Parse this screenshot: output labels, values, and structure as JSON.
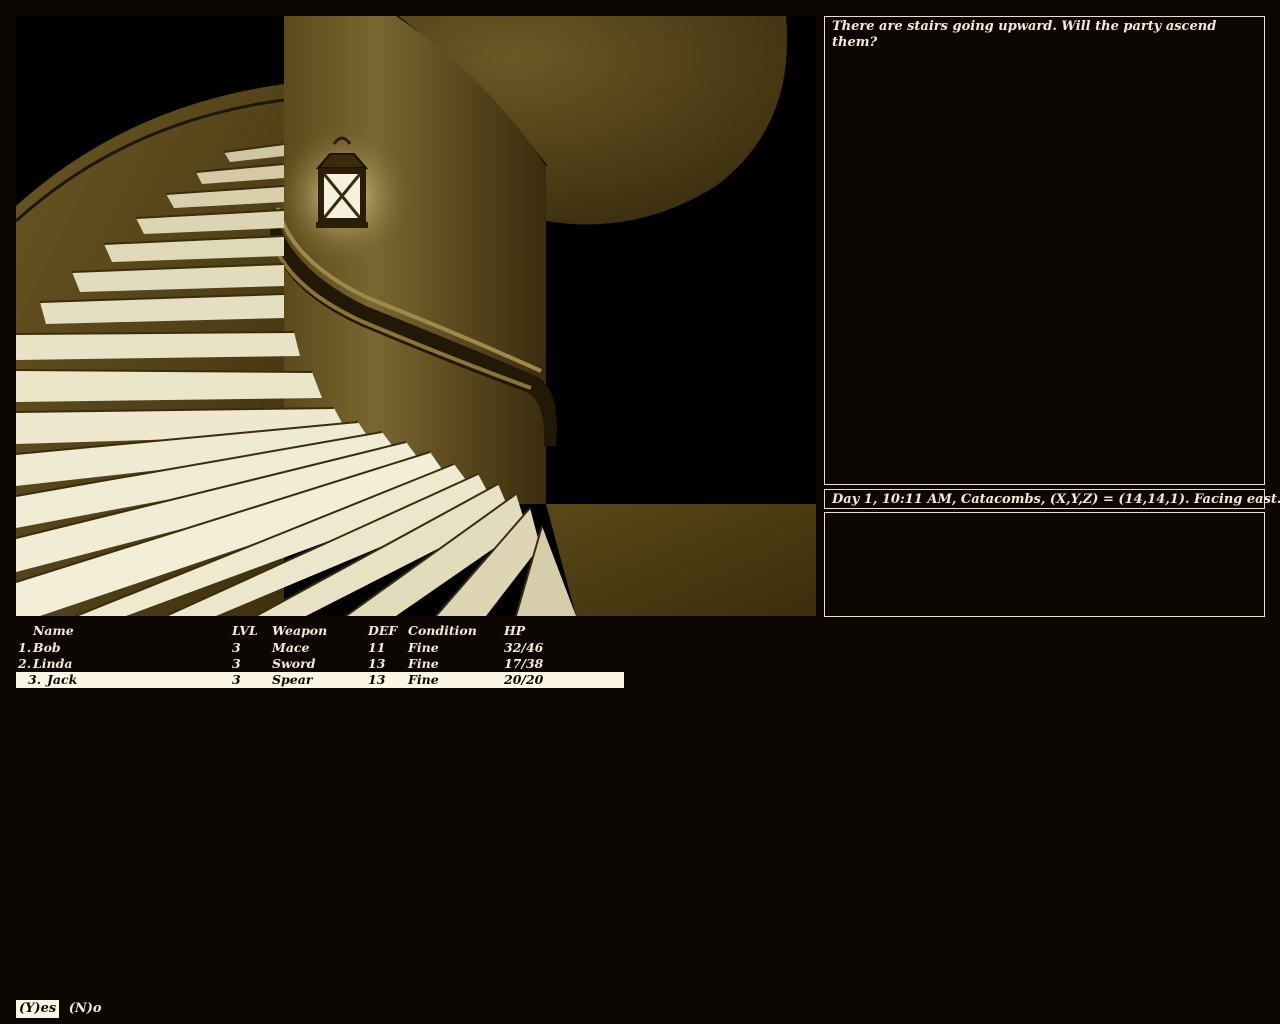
{
  "message": "There are stairs going upward. Will the party ascend them?",
  "status": "Day 1, 10:11 AM, Catacombs, (X,Y,Z) = (14,14,1). Facing east.",
  "party": {
    "headers": {
      "name": "Name",
      "lvl": "LVL",
      "weapon": "Weapon",
      "def": "DEF",
      "condition": "Condition",
      "hp": "HP"
    },
    "members": [
      {
        "num": "1.",
        "name": "Bob",
        "lvl": "3",
        "weapon": "Mace",
        "def": "11",
        "condition": "Fine",
        "hp": "32/46"
      },
      {
        "num": "2.",
        "name": "Linda",
        "lvl": "3",
        "weapon": "Sword",
        "def": "13",
        "condition": "Fine",
        "hp": "17/38"
      },
      {
        "num": "3.",
        "name": "Jack",
        "lvl": "3",
        "weapon": "Spear",
        "def": "13",
        "condition": "Fine",
        "hp": "20/20"
      }
    ],
    "selected_index": 2
  },
  "prompt": {
    "yes_label": "(Y)es",
    "no_label": "(N)o"
  },
  "scene": {
    "description_icon": "spiral-staircase-scene",
    "lantern_icon": "lantern-icon",
    "colors": {
      "sepia_dark": "#3a2d0e",
      "sepia_mid": "#7a6530",
      "sepia_light": "#e9e2c4",
      "background": "#0d0703",
      "text": "#f2ead6",
      "highlight": "#fbf5e3"
    }
  }
}
